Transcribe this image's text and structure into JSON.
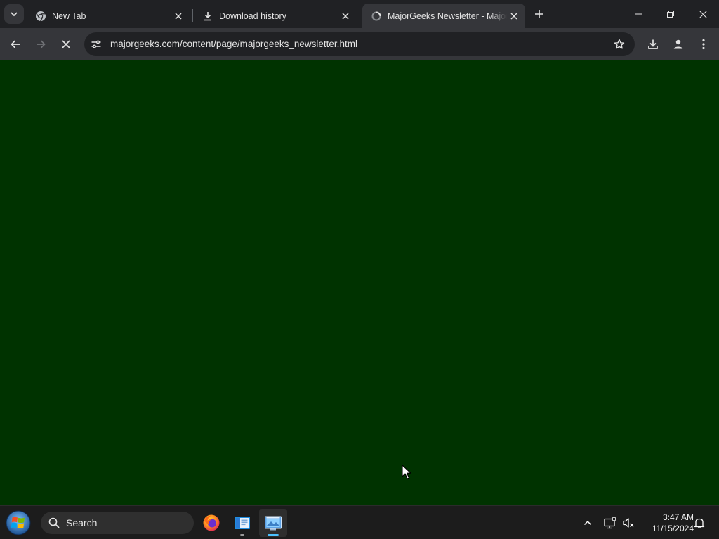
{
  "browser": {
    "tabs": [
      {
        "title": "New Tab",
        "icon": "chrome-icon"
      },
      {
        "title": "Download history",
        "icon": "download-icon"
      },
      {
        "title": "MajorGeeks Newsletter - MajorGeeks",
        "icon": "loading-icon",
        "active": true
      }
    ],
    "url_host": "majorgeeks.com",
    "url_path": "/content/page/majorgeeks_newsletter.html",
    "page_background": "#003300"
  },
  "taskbar": {
    "search_label": "Search",
    "time": "3:47 AM",
    "date": "11/15/2024",
    "apps": [
      "firefox-icon",
      "file-explorer-icon",
      "active-app-icon"
    ]
  },
  "colors": {
    "tabstrip": "#202124",
    "toolbar": "#35363a",
    "taskbar": "#1c1c1c",
    "accent": "#4cc2ff"
  }
}
